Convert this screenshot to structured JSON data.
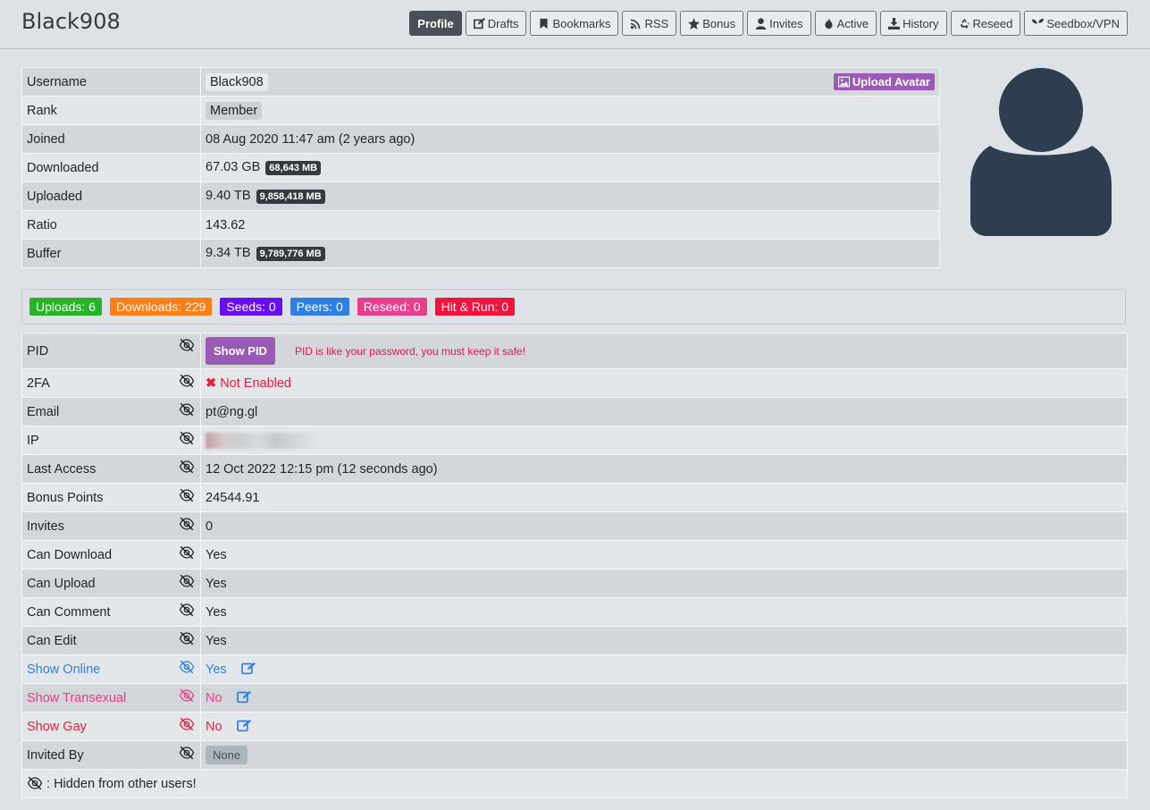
{
  "header": {
    "title": "Black908",
    "nav": [
      {
        "label": "Profile",
        "icon": "none",
        "active": true
      },
      {
        "label": "Drafts",
        "icon": "edit-icon"
      },
      {
        "label": "Bookmarks",
        "icon": "bookmark-icon"
      },
      {
        "label": "RSS",
        "icon": "rss-icon"
      },
      {
        "label": "Bonus",
        "icon": "star-icon"
      },
      {
        "label": "Invites",
        "icon": "user-icon"
      },
      {
        "label": "Active",
        "icon": "fire-icon"
      },
      {
        "label": "History",
        "icon": "download-icon"
      },
      {
        "label": "Reseed",
        "icon": "recycle-icon"
      },
      {
        "label": "Seedbox/VPN",
        "icon": "seedling-icon"
      }
    ]
  },
  "profile": {
    "username_label": "Username",
    "username": "Black908",
    "upload_avatar": "Upload Avatar",
    "rank_label": "Rank",
    "rank": "Member",
    "joined_label": "Joined",
    "joined": "08 Aug 2020 11:47 am (2 years ago)",
    "downloaded_label": "Downloaded",
    "downloaded": "67.03 GB",
    "downloaded_mb": "68,643 MB",
    "uploaded_label": "Uploaded",
    "uploaded": "9.40 TB",
    "uploaded_mb": "9,858,418 MB",
    "ratio_label": "Ratio",
    "ratio": "143.62",
    "buffer_label": "Buffer",
    "buffer": "9.34 TB",
    "buffer_mb": "9,789,776 MB"
  },
  "stats": {
    "uploads": "Uploads: 6",
    "downloads": "Downloads: 229",
    "seeds": "Seeds: 0",
    "peers": "Peers: 0",
    "reseed": "Reseed: 0",
    "hnr": "Hit & Run: 0",
    "colors": {
      "uploads": "#28b428",
      "downloads": "#fd7e14",
      "seeds": "#6610f2",
      "peers": "#2f7ee6",
      "reseed": "#e83e8c",
      "hnr": "#f0143c"
    }
  },
  "private": {
    "pid_label": "PID",
    "show_pid": "Show PID",
    "pid_warning": "PID is like your password, you must keep it safe!",
    "twofa_label": "2FA",
    "twofa": "Not Enabled",
    "email_label": "Email",
    "email": "pt@ng.gl",
    "ip_label": "IP",
    "last_access_label": "Last Access",
    "last_access": "12 Oct 2022 12:15 pm (12 seconds ago)",
    "bonus_label": "Bonus Points",
    "bonus": "24544.91",
    "invites_label": "Invites",
    "invites": "0",
    "can_download_label": "Can Download",
    "can_download": "Yes",
    "can_upload_label": "Can Upload",
    "can_upload": "Yes",
    "can_comment_label": "Can Comment",
    "can_comment": "Yes",
    "can_edit_label": "Can Edit",
    "can_edit": "Yes",
    "show_online_label": "Show Online",
    "show_online": "Yes",
    "show_trans_label": "Show Transexual",
    "show_trans": "No",
    "show_gay_label": "Show Gay",
    "show_gay": "No",
    "invited_by_label": "Invited By",
    "invited_by": "None",
    "legend": ": Hidden from other users!"
  }
}
